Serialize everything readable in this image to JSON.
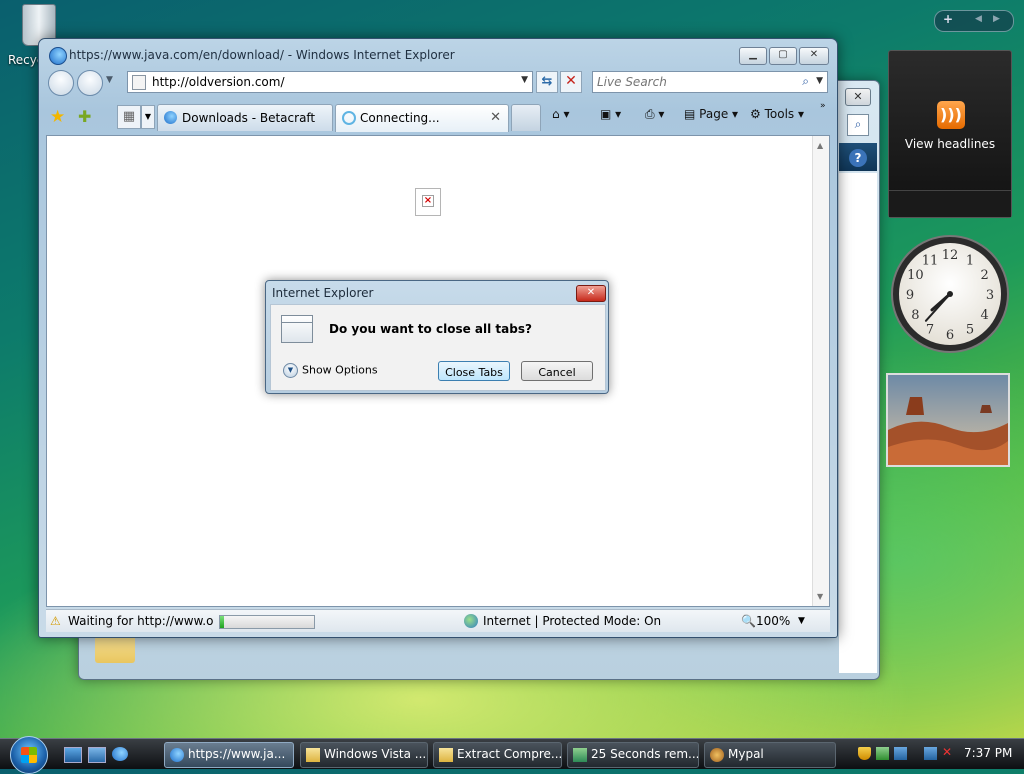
{
  "desktop": {
    "recycle_bin_label": "Recyc"
  },
  "ie": {
    "title": "https://www.java.com/en/download/ - Windows Internet Explorer",
    "address": "http://oldversion.com/",
    "search_placeholder": "Live Search",
    "tabs": [
      {
        "label": "Downloads - Betacraft",
        "active": false
      },
      {
        "label": "Connecting...",
        "active": true
      }
    ],
    "commands": {
      "page": "Page",
      "tools": "Tools"
    },
    "status": {
      "text": "Waiting for http://www.oldversion.com/",
      "progress_percent": 4,
      "zone": "Internet | Protected Mode: On",
      "zoom": "100%"
    }
  },
  "dialog": {
    "title": "Internet Explorer",
    "message": "Do you want to close all tabs?",
    "show_options": "Show Options",
    "close_tabs_button": "Close Tabs",
    "cancel_button": "Cancel"
  },
  "gadgets": {
    "feed_label": "View headlines",
    "clock_time": "7:37"
  },
  "taskbar": {
    "items": [
      {
        "label": "https://www.ja...",
        "active": true
      },
      {
        "label": "Windows Vista ...",
        "active": false
      },
      {
        "label": "Extract Compre...",
        "active": false
      },
      {
        "label": "25 Seconds rem...",
        "active": false
      },
      {
        "label": "Mypal",
        "active": false
      }
    ],
    "clock": "7:37 PM"
  }
}
